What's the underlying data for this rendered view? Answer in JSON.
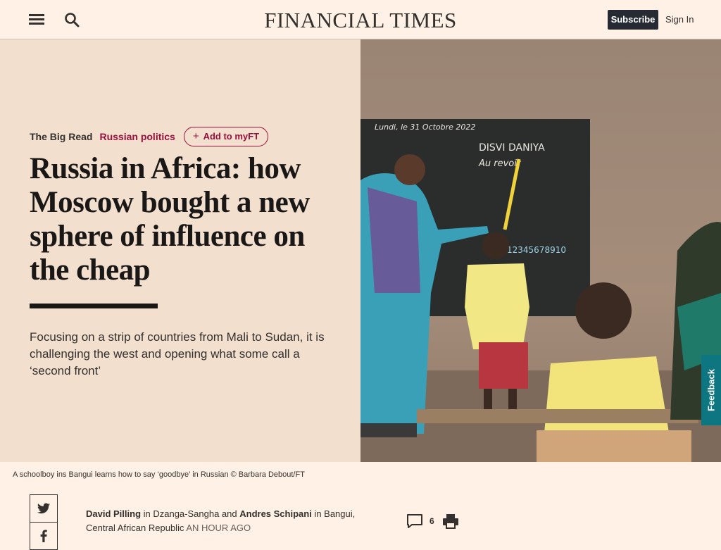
{
  "header": {
    "logo": "FINANCIAL TIMES",
    "subscribe_label": "Subscribe",
    "signin_label": "Sign In",
    "menu_icon": "hamburger-icon",
    "search_icon": "search-icon"
  },
  "article": {
    "genre": "The Big Read",
    "topic": "Russian politics",
    "add_myft_label": "Add to myFT",
    "headline": "Russia in Africa: how Moscow bought a new sphere of influence on the cheap",
    "standfirst": "Focusing on a strip of countries from Mali to Sudan, it is challenging the west and opening what some call a ‘second front’",
    "image_caption": "A schoolboy ins Bangui learns how to say ‘goodbye’ in Russian © Barbara Debout/FT",
    "board_text": {
      "date": "Lundi, le 31 Octobre 2022",
      "words": "DISVI DANIYA",
      "au_revoir": "Au revoir",
      "numbers": "12345678910"
    }
  },
  "byline": {
    "author1": "David Pilling",
    "in1": " in Dzanga-Sangha and ",
    "author2": "Andres Schipani",
    "in2": " in Bangui, Central African Republic ",
    "time": "an hour ago"
  },
  "tools": {
    "comment_count": "6"
  },
  "feedback_label": "Feedback",
  "colors": {
    "background": "#fff1e5",
    "hero_panel": "#f2dfce",
    "claret": "#990f3d",
    "subscribe_bg": "#262a33",
    "feedback_bg": "#0d7680"
  }
}
